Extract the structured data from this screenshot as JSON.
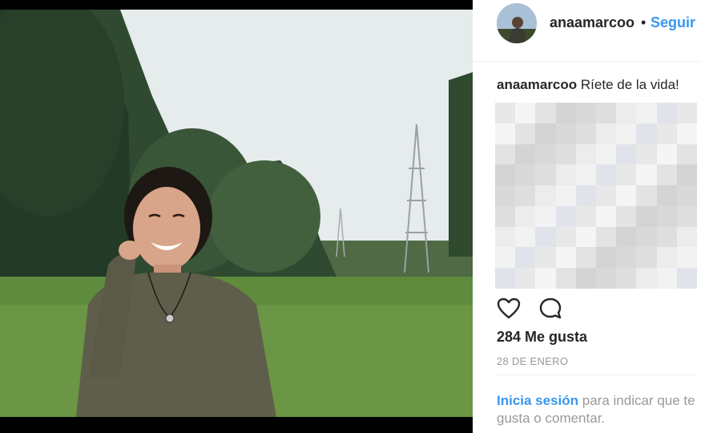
{
  "post": {
    "username": "anaamarcoo",
    "separator": "•",
    "follow_label": "Seguir",
    "caption_user": "anaamarcoo",
    "caption_text": "Ríete de la vida!",
    "likes": "284 Me gusta",
    "date": "28 DE ENERO",
    "login_link": "Inicia sesión",
    "login_text": " para indicar que te gusta o comentar.",
    "icons": [
      "heart-icon",
      "comment-icon"
    ]
  },
  "colors": {
    "accent": "#3897f0",
    "text": "#262626",
    "muted": "#999999"
  }
}
